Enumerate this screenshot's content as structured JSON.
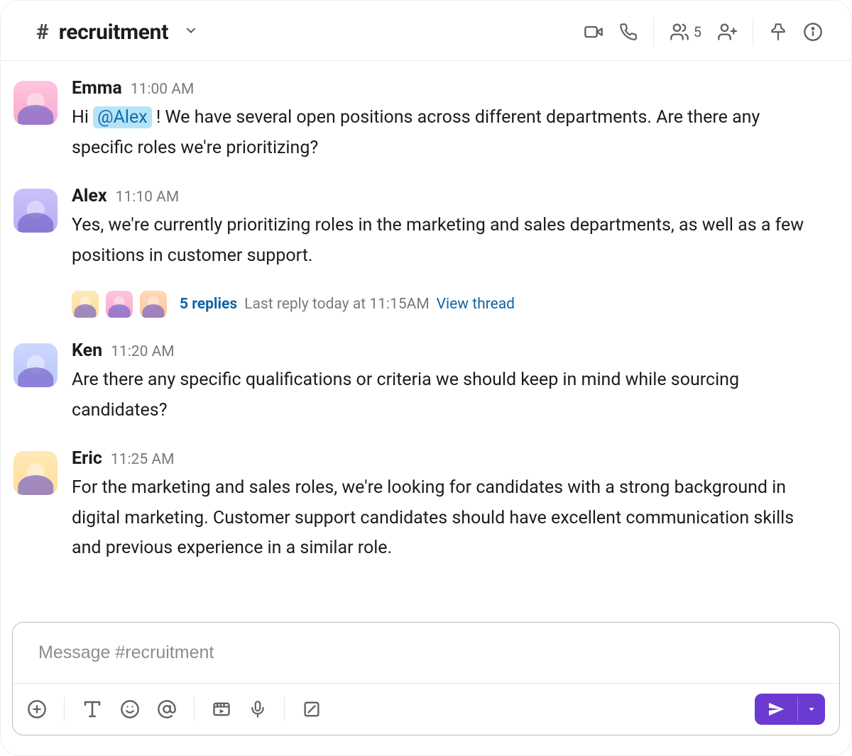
{
  "header": {
    "hash": "#",
    "channel_name": "recruitment",
    "member_count": "5"
  },
  "messages": [
    {
      "author": "Emma",
      "time": "11:00 AM",
      "text_pre": "Hi ",
      "mention": "@Alex",
      "text_post": " ! We have several open positions across different departments. Are there any specific roles we're prioritizing?",
      "avatar_class": "av-emma"
    },
    {
      "author": "Alex",
      "time": "11:10 AM",
      "text": "Yes, we're currently prioritizing roles in the marketing and sales departments, as well as a few positions in customer support.",
      "avatar_class": "av-alex",
      "thread": {
        "replies": "5 replies",
        "last": "Last reply today at 11:15AM",
        "view": "View thread"
      }
    },
    {
      "author": "Ken",
      "time": "11:20 AM",
      "text": "Are there any specific qualifications or criteria we should keep in mind while sourcing candidates?",
      "avatar_class": "av-ken"
    },
    {
      "author": "Eric",
      "time": "11:25 AM",
      "text": "For the marketing and sales roles, we're looking for candidates with a strong background in digital marketing. Customer support candidates should have excellent communication skills and previous experience in a similar role.",
      "avatar_class": "av-eric"
    }
  ],
  "composer": {
    "placeholder": "Message #recruitment"
  }
}
